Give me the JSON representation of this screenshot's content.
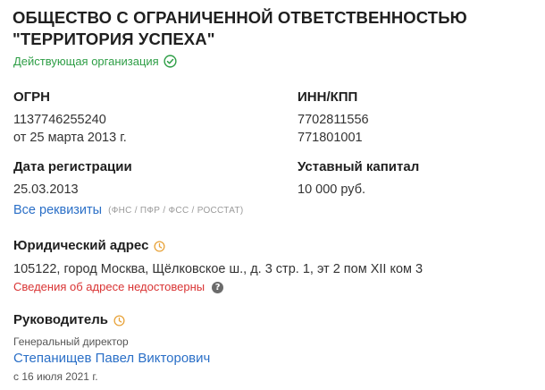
{
  "company": {
    "name": "ОБЩЕСТВО С ОГРАНИЧЕННОЙ ОТВЕТСТВЕННОСТЬЮ \"ТЕРРИТОРИЯ УСПЕХА\"",
    "status": "Действующая организация"
  },
  "ogrn": {
    "label": "ОГРН",
    "value": "1137746255240",
    "date": "от 25 марта 2013 г."
  },
  "inn_kpp": {
    "label": "ИНН/КПП",
    "inn": "7702811556",
    "kpp": "771801001"
  },
  "registration": {
    "label": "Дата регистрации",
    "value": "25.03.2013"
  },
  "capital": {
    "label": "Уставный капитал",
    "value": "10 000 руб."
  },
  "requisites": {
    "link": "Все реквизиты",
    "note": "(ФНС / ПФР / ФСС / РОССТАТ)"
  },
  "address": {
    "label": "Юридический адрес",
    "value": "105122, город Москва, Щёлковское ш., д. 3 стр. 1, эт 2 пом XII ком 3",
    "warning": "Сведения об адресе недостоверны"
  },
  "head": {
    "label": "Руководитель",
    "position": "Генеральный директор",
    "name": "Степанищев Павел Викторович",
    "since": "с 16 июля 2021 г."
  },
  "colors": {
    "accent_green": "#2e9e46",
    "link_blue": "#2a6fc7",
    "warning_red": "#d93434",
    "history_orange": "#e8a33a"
  },
  "icons": {
    "status": "check-circle-icon",
    "history": "clock-icon",
    "help": "question-icon"
  }
}
